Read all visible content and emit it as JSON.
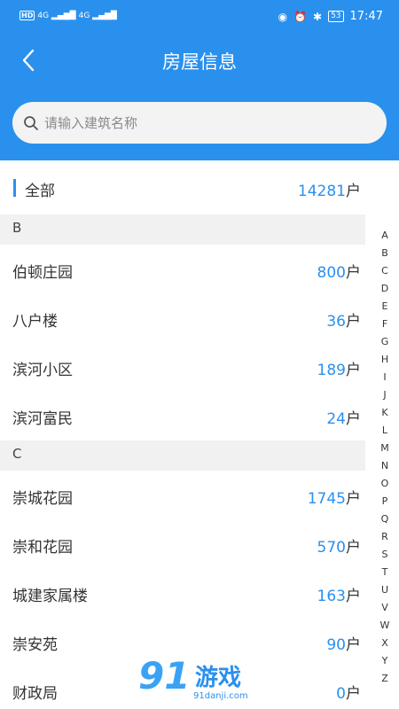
{
  "status_bar": {
    "left_badge": "HD",
    "signal1": "4G",
    "signal2": "4G",
    "battery": "53",
    "time": "17:47"
  },
  "nav": {
    "title": "房屋信息"
  },
  "search": {
    "placeholder": "请输入建筑名称"
  },
  "all": {
    "label": "全部",
    "count": "14281",
    "unit": "户"
  },
  "sections": [
    {
      "letter": "B",
      "items": [
        {
          "name": "伯顿庄园",
          "count": "800",
          "unit": "户"
        },
        {
          "name": "八户楼",
          "count": "36",
          "unit": "户"
        },
        {
          "name": "滨河小区",
          "count": "189",
          "unit": "户"
        },
        {
          "name": "滨河富民",
          "count": "24",
          "unit": "户"
        }
      ]
    },
    {
      "letter": "C",
      "items": [
        {
          "name": "崇城花园",
          "count": "1745",
          "unit": "户"
        },
        {
          "name": "崇和花园",
          "count": "570",
          "unit": "户"
        },
        {
          "name": "城建家属楼",
          "count": "163",
          "unit": "户"
        },
        {
          "name": "崇安苑",
          "count": "90",
          "unit": "户"
        },
        {
          "name": "财政局",
          "count": "0",
          "unit": "户"
        }
      ]
    }
  ],
  "index_letters": [
    "A",
    "B",
    "C",
    "D",
    "E",
    "F",
    "G",
    "H",
    "I",
    "J",
    "K",
    "L",
    "M",
    "N",
    "O",
    "P",
    "Q",
    "R",
    "S",
    "T",
    "U",
    "V",
    "W",
    "X",
    "Y",
    "Z"
  ],
  "watermark": {
    "brand_num": "91",
    "brand_text": "游戏",
    "url": "91danji.com"
  },
  "colors": {
    "primary": "#2a90ee",
    "section_bg": "#f1f1f1",
    "text": "#333333"
  }
}
